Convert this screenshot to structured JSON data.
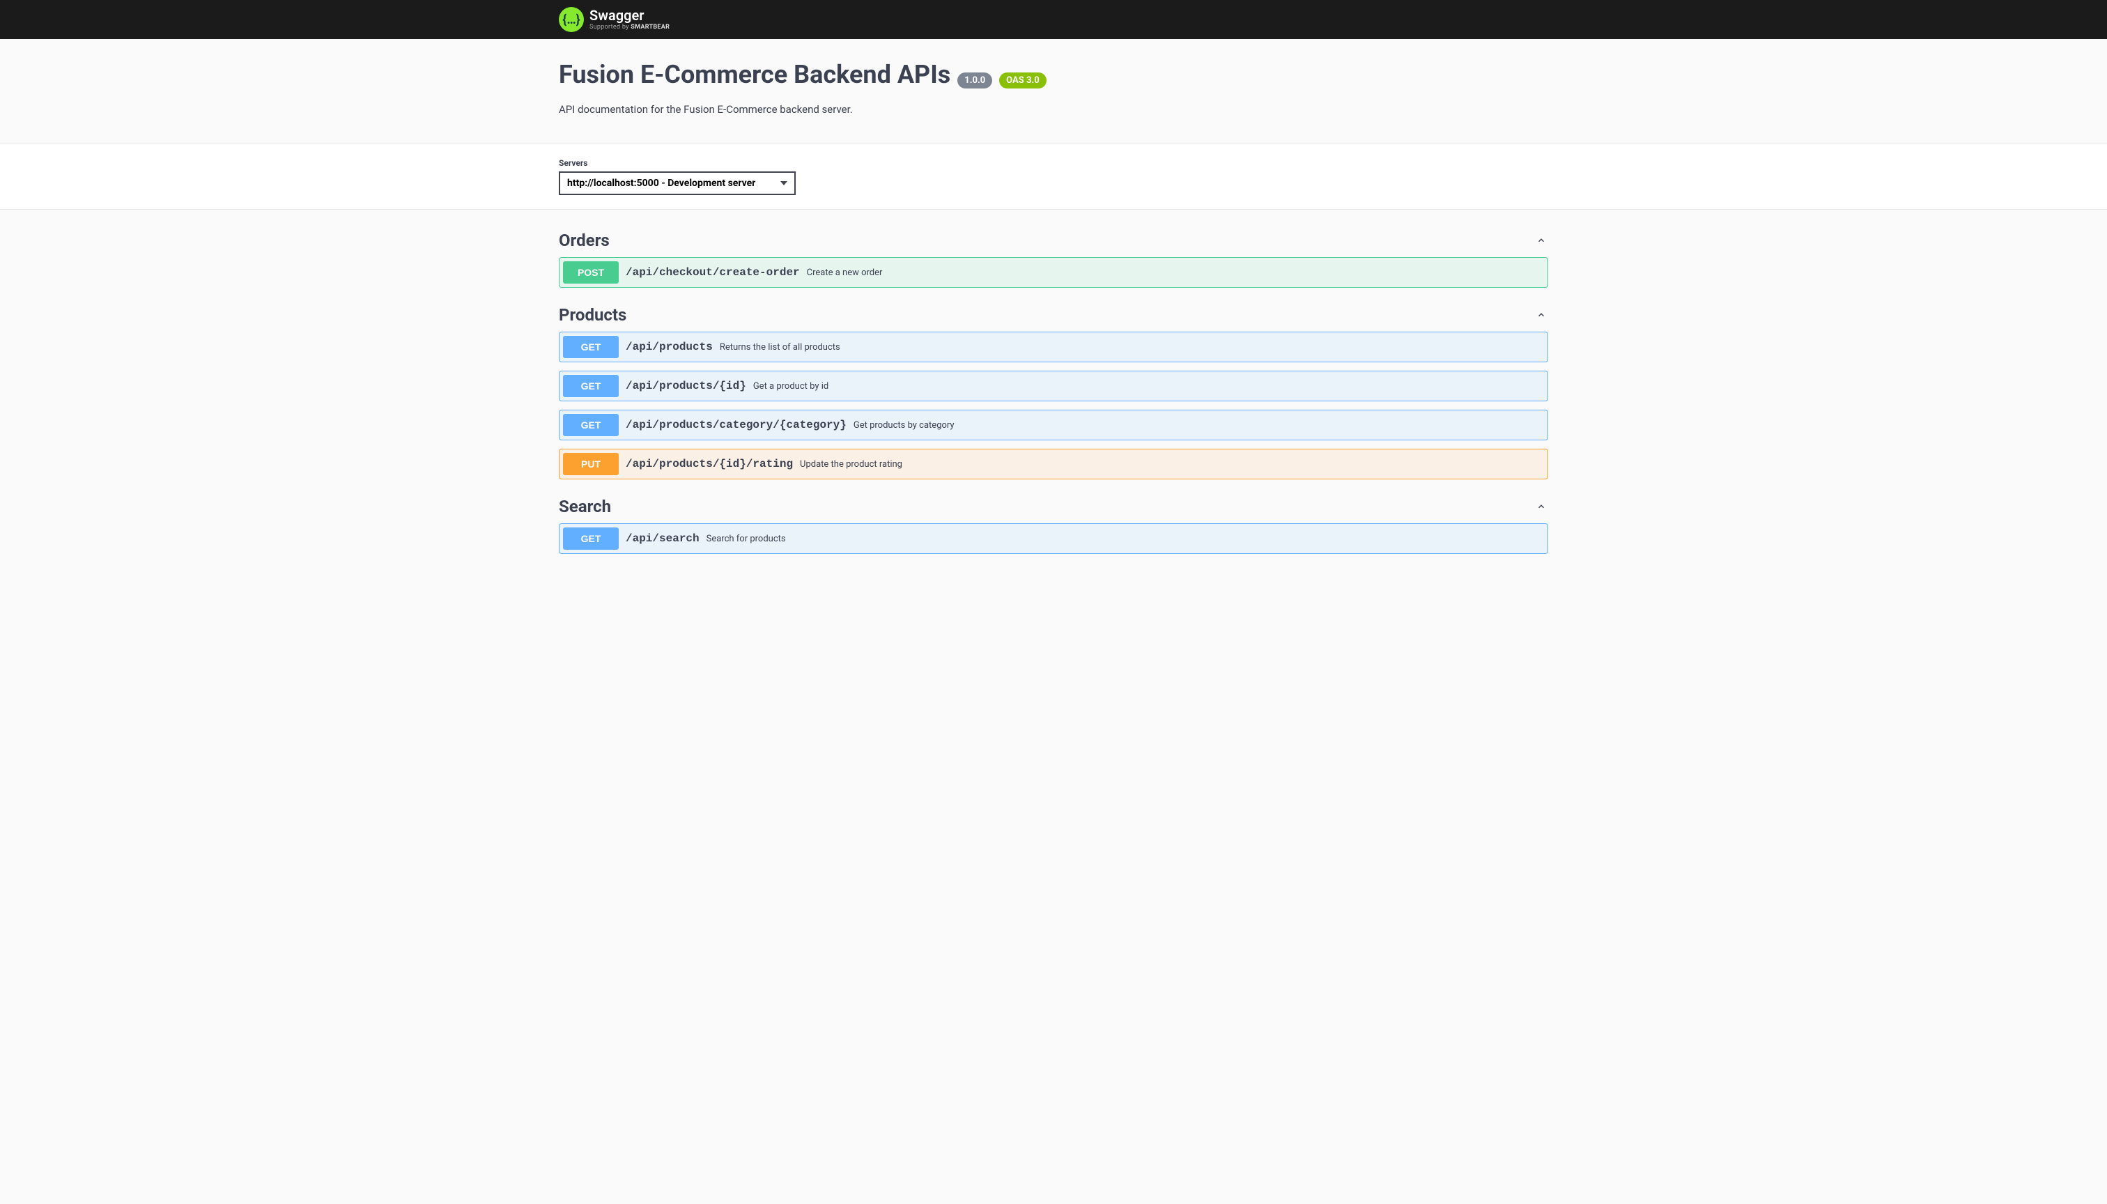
{
  "header": {
    "brand": "Swagger",
    "tagline_prefix": "Supported by ",
    "tagline_strong": "SMARTBEAR"
  },
  "info": {
    "title": "Fusion E-Commerce Backend APIs",
    "version": "1.0.0",
    "oas": "OAS 3.0",
    "description": "API documentation for the Fusion E-Commerce backend server."
  },
  "servers": {
    "label": "Servers",
    "selected": "http://localhost:5000 - Development server"
  },
  "tags": [
    {
      "name": "Orders",
      "ops": [
        {
          "method": "POST",
          "method_class": "post",
          "path": "/api/checkout/create-order",
          "desc": "Create a new order"
        }
      ]
    },
    {
      "name": "Products",
      "ops": [
        {
          "method": "GET",
          "method_class": "get",
          "path": "/api/products",
          "desc": "Returns the list of all products"
        },
        {
          "method": "GET",
          "method_class": "get",
          "path": "/api/products/{id}",
          "desc": "Get a product by id"
        },
        {
          "method": "GET",
          "method_class": "get",
          "path": "/api/products/category/{category}",
          "desc": "Get products by category"
        },
        {
          "method": "PUT",
          "method_class": "put",
          "path": "/api/products/{id}/rating",
          "desc": "Update the product rating"
        }
      ]
    },
    {
      "name": "Search",
      "ops": [
        {
          "method": "GET",
          "method_class": "get",
          "path": "/api/search",
          "desc": "Search for products"
        }
      ]
    }
  ]
}
